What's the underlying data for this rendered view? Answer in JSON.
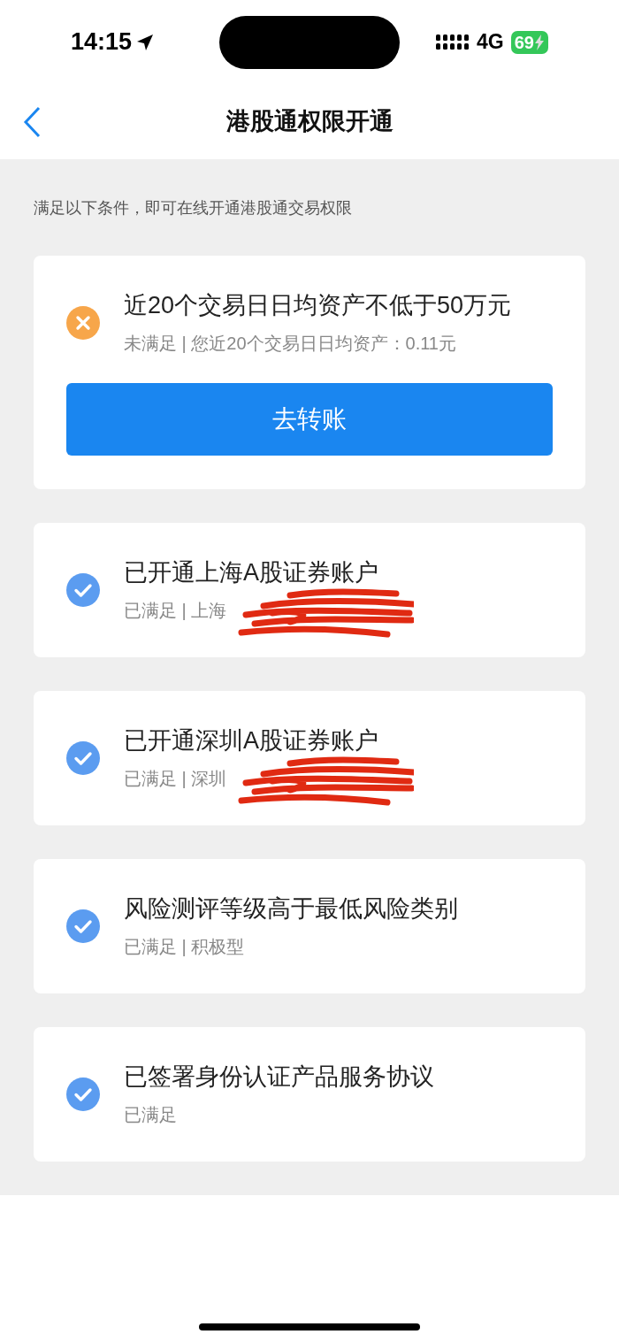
{
  "status_bar": {
    "time": "14:15",
    "network": "4G",
    "battery": "69"
  },
  "header": {
    "title": "港股通权限开通"
  },
  "intro": "满足以下条件，即可在线开通港股通交易权限",
  "conditions": [
    {
      "title": "近20个交易日日均资产不低于50万元",
      "status": "未满足 | 您近20个交易日日均资产：0.11元",
      "met": false,
      "action": "去转账"
    },
    {
      "title": "已开通上海A股证券账户",
      "status": "已满足 | 上海",
      "met": true,
      "redacted": true
    },
    {
      "title": "已开通深圳A股证券账户",
      "status": "已满足 | 深圳",
      "met": true,
      "redacted": true
    },
    {
      "title": "风险测评等级高于最低风险类别",
      "status": "已满足 | 积极型",
      "met": true
    },
    {
      "title": "已签署身份认证产品服务协议",
      "status": "已满足",
      "met": true
    }
  ]
}
